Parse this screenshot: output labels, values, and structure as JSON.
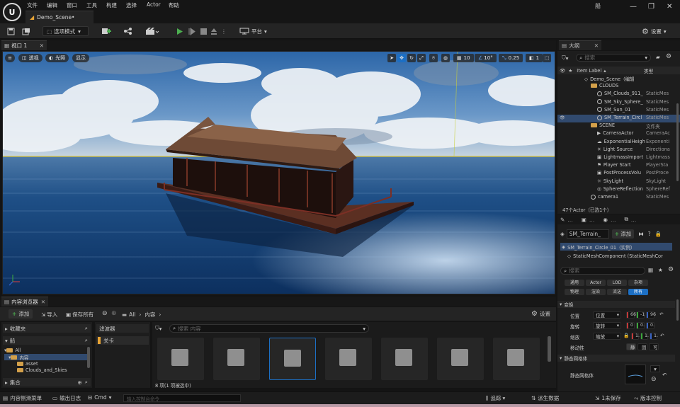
{
  "menu": [
    "文件",
    "编辑",
    "窗口",
    "工具",
    "构建",
    "选择",
    "Actor",
    "帮助"
  ],
  "document_tab": "Demo_Scene•",
  "window": {
    "project": "船"
  },
  "toolbar": {
    "mode": "选项模式",
    "platform": "平台",
    "settings": "设置"
  },
  "viewport": {
    "tab": "视口 1",
    "perspective": "透视",
    "lit": "光照",
    "show": "显示",
    "grid_snap": "10",
    "rotation_snap": "10°",
    "scale_snap": "0.25",
    "camera_speed": "1",
    "colors": {
      "sky_top": "#2e6fb5",
      "sea": "#0f3a6a",
      "horizon": "#d8c23a"
    }
  },
  "content_browser": {
    "tab": "内容浏览器",
    "add": "添加",
    "import": "导入",
    "save_all": "保存所有",
    "path": [
      "All",
      "内容"
    ],
    "settings": "设置",
    "favorites": "收藏夹",
    "project": "船",
    "tree": [
      "All",
      "内容",
      "asset",
      "Clouds_and_Skies"
    ],
    "collections": "集合",
    "filters": "滤波器",
    "filter_item": "关卡",
    "search_placeholder": "搜索 内容",
    "item_count": "8 项(1 项被选中)"
  },
  "statusbar": {
    "content_drawer": "内容侧滑菜单",
    "output_log": "输出日志",
    "cmd": "Cmd",
    "cmd_placeholder": "输入控制台命令",
    "trace": "追踪",
    "derived_data": "派生数据",
    "unsaved": "1未保存",
    "revision_control": "版本控制"
  },
  "outliner": {
    "tab": "大纲",
    "search_placeholder": "搜索",
    "col_label": "Item Label",
    "col_type": "类型",
    "rows": [
      {
        "indent": 0,
        "kind": "level",
        "label": "Demo_Scene（编辑器）",
        "type": ""
      },
      {
        "indent": 1,
        "kind": "folder",
        "label": "CLOUDS",
        "type": ""
      },
      {
        "indent": 2,
        "kind": "mesh",
        "label": "SM_Clouds_911_",
        "type": "StaticMes"
      },
      {
        "indent": 2,
        "kind": "mesh",
        "label": "SM_Sky_Sphere_",
        "type": "StaticMes"
      },
      {
        "indent": 2,
        "kind": "mesh",
        "label": "SM_Sun_01",
        "type": "StaticMes"
      },
      {
        "indent": 2,
        "kind": "mesh",
        "label": "SM_Terrain_Circl",
        "type": "StaticMes",
        "selected": true
      },
      {
        "indent": 1,
        "kind": "folder",
        "label": "SCENE",
        "type": "文件夹"
      },
      {
        "indent": 2,
        "kind": "camera",
        "label": "CameraActor",
        "type": "CameraAc"
      },
      {
        "indent": 2,
        "kind": "fog",
        "label": "ExponentialHeigh",
        "type": "Exponenti"
      },
      {
        "indent": 2,
        "kind": "light",
        "label": "Light Source",
        "type": "Directiona"
      },
      {
        "indent": 2,
        "kind": "box",
        "label": "LightmassImport",
        "type": "Lightmass"
      },
      {
        "indent": 2,
        "kind": "player",
        "label": "Player Start",
        "type": "PlayerSta"
      },
      {
        "indent": 2,
        "kind": "box",
        "label": "PostProcessVolu",
        "type": "PostProce"
      },
      {
        "indent": 2,
        "kind": "sky",
        "label": "SkyLight",
        "type": "SkyLight"
      },
      {
        "indent": 2,
        "kind": "sphere",
        "label": "SphereReflection",
        "type": "SphereRef"
      },
      {
        "indent": 1,
        "kind": "mesh",
        "label": "camera1",
        "type": "StaticMes"
      }
    ],
    "count": "47个Actor（已选1个）"
  },
  "details": {
    "actor_name": "SM_Terrain_",
    "add": "添加",
    "instance": "SM_Terrain_Circle_01（实例）",
    "component": "StaticMeshComponent (StaticMeshCor",
    "search_placeholder": "搜索",
    "tabs_row1": [
      "通用",
      "Actor",
      "LOD",
      "杂项"
    ],
    "tabs_row2": [
      "物理",
      "渲染",
      "流送",
      "所有"
    ],
    "section_transform": "变换",
    "location": "位置",
    "rotation": "旋转",
    "scale": "缩放",
    "loc_vals": [
      "66",
      "-1",
      "96"
    ],
    "rot_vals": [
      "0",
      "0.",
      "0."
    ],
    "scale_vals": [
      "1.",
      "1.",
      "1."
    ],
    "mobility": "移动性",
    "mobility_opts": [
      "静",
      "固",
      "可"
    ],
    "section_mesh": "静态网格体",
    "mesh_label": "静态网格体"
  }
}
